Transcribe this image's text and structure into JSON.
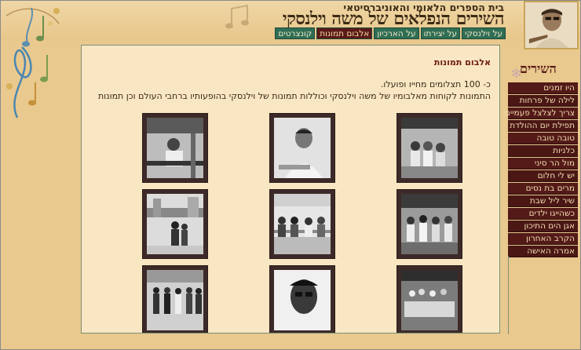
{
  "header": {
    "subtitle": "בית הספרים הלאומי והאוניברסיטאי",
    "title": "השירים הנפלאים של משה וילנסקי"
  },
  "topnav": {
    "tabs": [
      {
        "label": "על וילנסקי",
        "active": false
      },
      {
        "label": "על יצירתו",
        "active": false
      },
      {
        "label": "על הארכיון",
        "active": false
      },
      {
        "label": "אלבום תמונות",
        "active": true
      },
      {
        "label": "קונצרטים",
        "active": false
      }
    ]
  },
  "main": {
    "title": "אלבום תמונות",
    "text1": "כ- 100 תצלומים מחייו ופועלו.",
    "text2": "התמונות לקוחות מאלבומיו של משה וילנסקי וכוללות תמונות של וילנסקי בהופעותיו ברחבי העולם וכן תמונות"
  },
  "sidebar": {
    "title": "השירים",
    "items": [
      {
        "label": "היו זמנים"
      },
      {
        "label": "לילה של פרחות"
      },
      {
        "label": "צריך לצלצל פעמיים"
      },
      {
        "label": "תפילת יום ההולדת"
      },
      {
        "label": "טובה טובה"
      },
      {
        "label": "כלניות"
      },
      {
        "label": "מול הר סיני"
      },
      {
        "label": "יש לי חלום"
      },
      {
        "label": "מרים בת נסים"
      },
      {
        "label": "שיר ליל שבת"
      },
      {
        "label": "כשהייגו ילדים"
      },
      {
        "label": "אגן הים התיכון"
      },
      {
        "label": "הקרב האחרון"
      },
      {
        "label": "אמרה האישה"
      }
    ]
  },
  "colors": {
    "nav_green": "#2f6e55",
    "nav_active": "#5a1a18",
    "sidebar_bg": "#4a1715",
    "panel_bg": "#f9e6c3"
  }
}
